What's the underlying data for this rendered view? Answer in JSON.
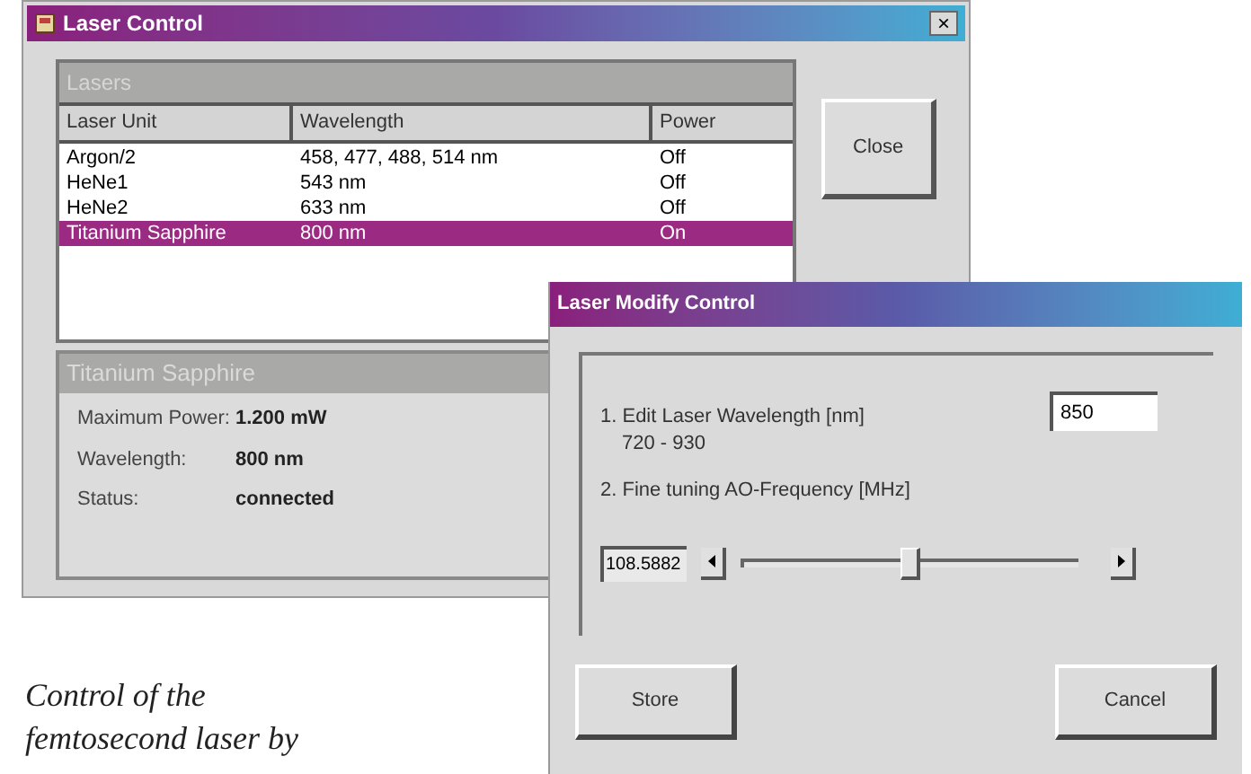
{
  "main_window": {
    "title": "Laser Control",
    "close_glyph": "×",
    "lasers_panel": {
      "title": "Lasers",
      "columns": [
        "Laser Unit",
        "Wavelength",
        "Power"
      ],
      "rows": [
        {
          "cells": [
            "Argon/2",
            "458, 477, 488, 514 nm",
            "Off"
          ],
          "selected": false
        },
        {
          "cells": [
            "HeNe1",
            "543 nm",
            "Off"
          ],
          "selected": false
        },
        {
          "cells": [
            "HeNe2",
            "633 nm",
            "Off"
          ],
          "selected": false
        },
        {
          "cells": [
            "Titanium Sapphire",
            "800 nm",
            "On"
          ],
          "selected": true
        }
      ]
    },
    "detail_panel": {
      "title": "Titanium Sapphire",
      "fields": [
        {
          "label": "Maximum Power:",
          "value": "1.200 mW"
        },
        {
          "label": "Wavelength:",
          "value": "800 nm"
        },
        {
          "label": "Status:",
          "value": "connected"
        }
      ]
    },
    "close_button": "Close"
  },
  "modify_dialog": {
    "title": "Laser Modify Control",
    "wavelength_label": "1. Edit Laser Wavelength [nm]",
    "wavelength_value": "850",
    "wavelength_range": "720 - 930",
    "frequency_label": "2. Fine tuning AO-Frequency  [MHz]",
    "frequency_value": "108.5882",
    "slider": {
      "level": 0.5
    },
    "buttons": [
      "Store",
      "Cancel"
    ]
  },
  "caption": [
    "Control of the",
    "femtosecond laser by"
  ]
}
